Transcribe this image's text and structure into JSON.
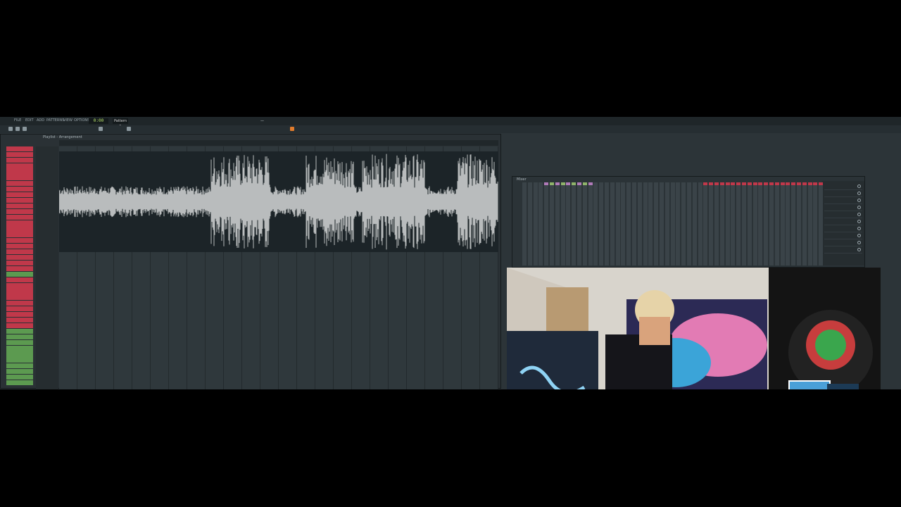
{
  "daw": {
    "menu_items": [
      "FILE",
      "EDIT",
      "ADD",
      "PATTERNS",
      "VIEW",
      "OPTIONS",
      "TOOLS",
      "HELP"
    ],
    "song_position": "0:00",
    "tempo_label": "Pattern 1",
    "hint_text": "—",
    "playlist_title": "Playlist - Arrangement",
    "marker_1": "",
    "marker_2": ""
  },
  "playlist": {
    "tracks": [
      {
        "label": "",
        "color": "red"
      },
      {
        "label": "",
        "color": "red"
      },
      {
        "label": "",
        "color": "red"
      },
      {
        "label": "",
        "color": "red"
      },
      {
        "label": "",
        "color": "red"
      },
      {
        "label": "",
        "color": "red"
      },
      {
        "label": "",
        "color": "red"
      },
      {
        "label": "",
        "color": "red"
      },
      {
        "label": "",
        "color": "red"
      },
      {
        "label": "",
        "color": "red"
      },
      {
        "label": "",
        "color": "red"
      },
      {
        "label": "",
        "color": "red"
      },
      {
        "label": "",
        "color": "red"
      },
      {
        "label": "",
        "color": "red"
      },
      {
        "label": "",
        "color": "red"
      },
      {
        "label": "",
        "color": "red"
      },
      {
        "label": "",
        "color": "red"
      },
      {
        "label": "",
        "color": "red"
      },
      {
        "label": "",
        "color": "red"
      },
      {
        "label": "",
        "color": "red"
      },
      {
        "label": "",
        "color": "red"
      },
      {
        "label": "",
        "color": "red"
      },
      {
        "label": "",
        "color": "green"
      },
      {
        "label": "",
        "color": "red"
      },
      {
        "label": "",
        "color": "red"
      },
      {
        "label": "",
        "color": "red"
      },
      {
        "label": "",
        "color": "red"
      },
      {
        "label": "",
        "color": "red"
      },
      {
        "label": "",
        "color": "red"
      },
      {
        "label": "",
        "color": "red"
      },
      {
        "label": "",
        "color": "red"
      },
      {
        "label": "",
        "color": "red"
      },
      {
        "label": "",
        "color": "green"
      },
      {
        "label": "",
        "color": "green"
      },
      {
        "label": "",
        "color": "green"
      },
      {
        "label": "",
        "color": "green"
      },
      {
        "label": "",
        "color": "green"
      },
      {
        "label": "",
        "color": "green"
      },
      {
        "label": "",
        "color": "green"
      },
      {
        "label": "",
        "color": "green"
      },
      {
        "label": "",
        "color": "green"
      },
      {
        "label": "",
        "color": "green"
      }
    ]
  },
  "mixer": {
    "title": "Mixer",
    "insert_slots": [
      "",
      "",
      "",
      "",
      "",
      "",
      "",
      "",
      "",
      ""
    ]
  },
  "colors": {
    "accent_red": "#c0384a",
    "accent_green": "#5c9a50",
    "lcd_green": "#b7e26a",
    "daw_bg": "#2c3438"
  },
  "icons": [
    "record-icon",
    "play-icon",
    "stop-icon",
    "pattern-icon",
    "snap-icon"
  ]
}
